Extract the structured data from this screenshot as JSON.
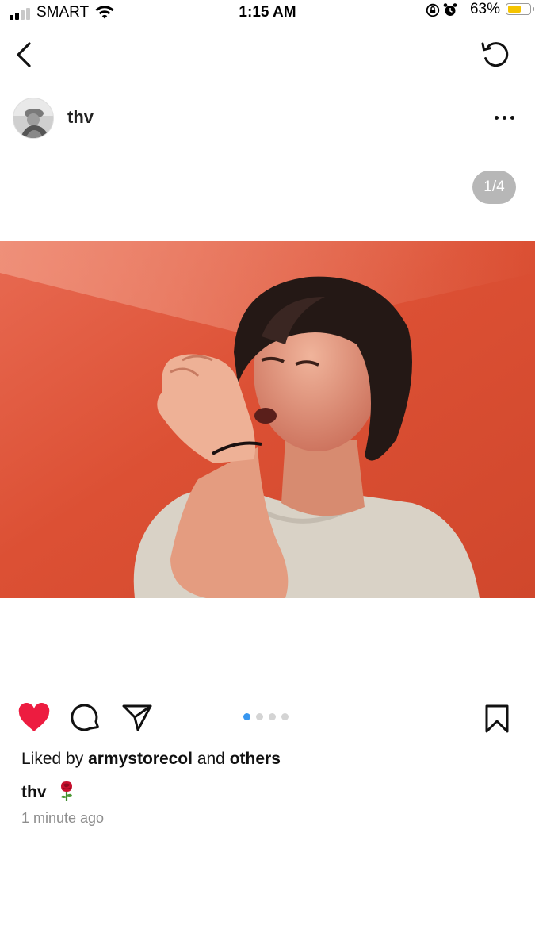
{
  "status_bar": {
    "carrier": "SMART",
    "time": "1:15 AM",
    "battery_percent": "63%",
    "battery_level": 0.63,
    "signal_bars": 2,
    "icons": [
      "signal-icon",
      "wifi-icon",
      "orientation-lock-icon",
      "alarm-icon",
      "battery-icon"
    ]
  },
  "nav": {
    "back_icon": "chevron-left-icon",
    "refresh_icon": "refresh-icon"
  },
  "post": {
    "username": "thv",
    "more_icon": "more-horizontal-icon",
    "counter": "1/4",
    "carousel_total": 4,
    "carousel_active": 1
  },
  "actions": {
    "like_icon": "heart-filled-icon",
    "comment_icon": "comment-icon",
    "share_icon": "paper-plane-icon",
    "save_icon": "bookmark-icon",
    "like_color": "#ed1c40",
    "dot_active_color": "#3897f0"
  },
  "likes": {
    "prefix": "Liked by",
    "user": "armystorecol",
    "connector": "and",
    "others": "others"
  },
  "caption": {
    "username": "thv",
    "emoji": "rose-emoji"
  },
  "timestamp": "1 minute ago"
}
